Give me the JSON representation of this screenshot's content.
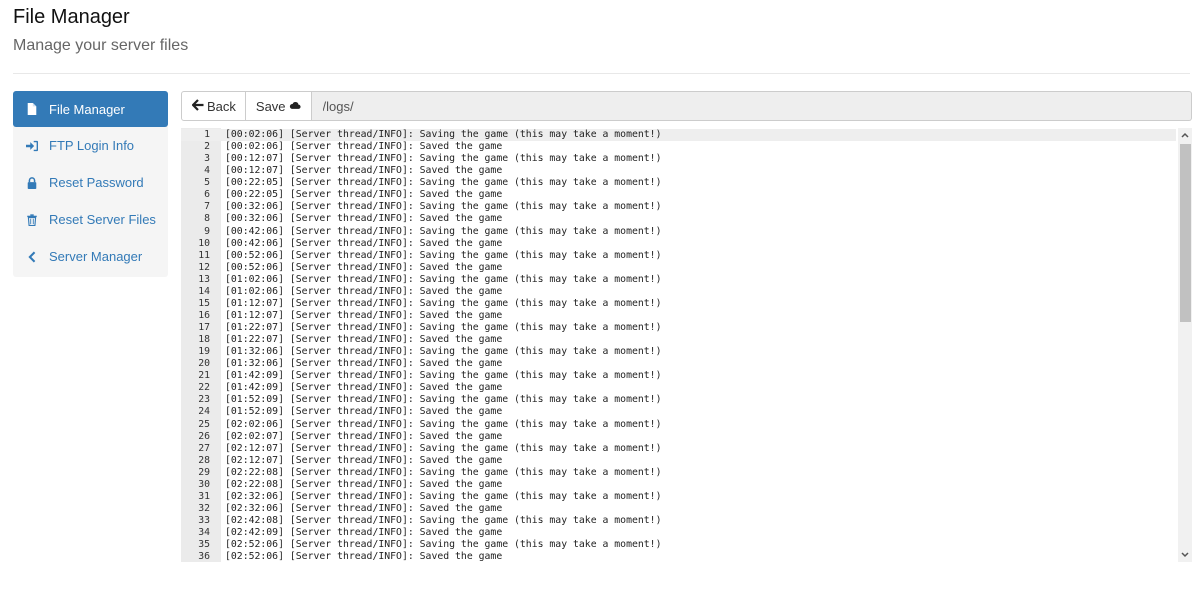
{
  "header": {
    "title": "File Manager",
    "subtitle": "Manage your server files"
  },
  "sidebar": {
    "items": [
      {
        "label": "File Manager",
        "icon": "file-icon",
        "active": true
      },
      {
        "label": "FTP Login Info",
        "icon": "sign-in-icon",
        "active": false
      },
      {
        "label": "Reset Password",
        "icon": "lock-icon",
        "active": false
      },
      {
        "label": "Reset Server Files",
        "icon": "trash-icon",
        "active": false
      },
      {
        "label": "Server Manager",
        "icon": "chevron-left-icon",
        "active": false
      }
    ]
  },
  "toolbar": {
    "back_label": "Back",
    "save_label": "Save",
    "path": "/logs/"
  },
  "editor": {
    "lines": [
      "[00:02:06] [Server thread/INFO]: Saving the game (this may take a moment!)",
      "[00:02:06] [Server thread/INFO]: Saved the game",
      "[00:12:07] [Server thread/INFO]: Saving the game (this may take a moment!)",
      "[00:12:07] [Server thread/INFO]: Saved the game",
      "[00:22:05] [Server thread/INFO]: Saving the game (this may take a moment!)",
      "[00:22:05] [Server thread/INFO]: Saved the game",
      "[00:32:06] [Server thread/INFO]: Saving the game (this may take a moment!)",
      "[00:32:06] [Server thread/INFO]: Saved the game",
      "[00:42:06] [Server thread/INFO]: Saving the game (this may take a moment!)",
      "[00:42:06] [Server thread/INFO]: Saved the game",
      "[00:52:06] [Server thread/INFO]: Saving the game (this may take a moment!)",
      "[00:52:06] [Server thread/INFO]: Saved the game",
      "[01:02:06] [Server thread/INFO]: Saving the game (this may take a moment!)",
      "[01:02:06] [Server thread/INFO]: Saved the game",
      "[01:12:07] [Server thread/INFO]: Saving the game (this may take a moment!)",
      "[01:12:07] [Server thread/INFO]: Saved the game",
      "[01:22:07] [Server thread/INFO]: Saving the game (this may take a moment!)",
      "[01:22:07] [Server thread/INFO]: Saved the game",
      "[01:32:06] [Server thread/INFO]: Saving the game (this may take a moment!)",
      "[01:32:06] [Server thread/INFO]: Saved the game",
      "[01:42:09] [Server thread/INFO]: Saving the game (this may take a moment!)",
      "[01:42:09] [Server thread/INFO]: Saved the game",
      "[01:52:09] [Server thread/INFO]: Saving the game (this may take a moment!)",
      "[01:52:09] [Server thread/INFO]: Saved the game",
      "[02:02:06] [Server thread/INFO]: Saving the game (this may take a moment!)",
      "[02:02:07] [Server thread/INFO]: Saved the game",
      "[02:12:07] [Server thread/INFO]: Saving the game (this may take a moment!)",
      "[02:12:07] [Server thread/INFO]: Saved the game",
      "[02:22:08] [Server thread/INFO]: Saving the game (this may take a moment!)",
      "[02:22:08] [Server thread/INFO]: Saved the game",
      "[02:32:06] [Server thread/INFO]: Saving the game (this may take a moment!)",
      "[02:32:06] [Server thread/INFO]: Saved the game",
      "[02:42:08] [Server thread/INFO]: Saving the game (this may take a moment!)",
      "[02:42:09] [Server thread/INFO]: Saved the game",
      "[02:52:06] [Server thread/INFO]: Saving the game (this may take a moment!)",
      "[02:52:06] [Server thread/INFO]: Saved the game"
    ]
  }
}
